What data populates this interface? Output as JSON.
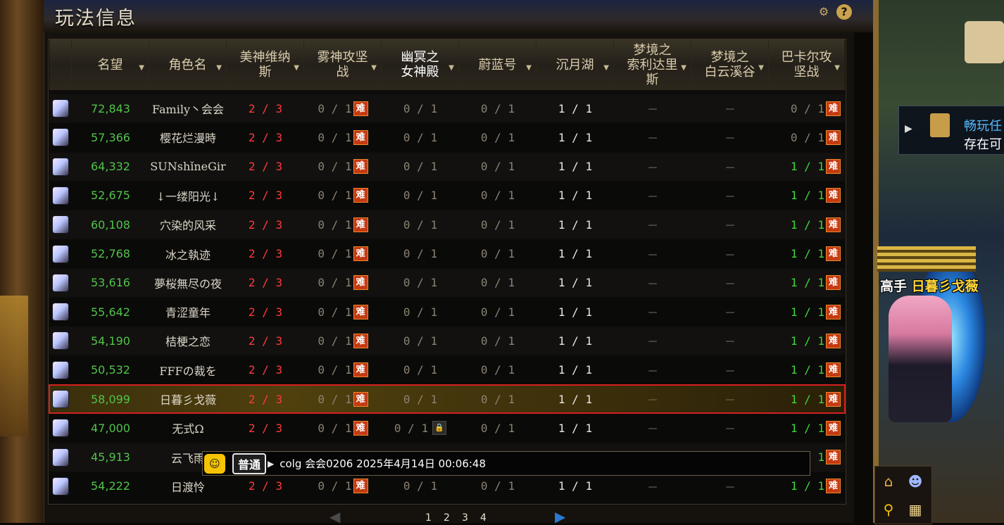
{
  "title": "玩法信息",
  "icons": {
    "settings": "gear-icon",
    "help": "?"
  },
  "header": [
    {
      "label": "名望",
      "special": false
    },
    {
      "label": "角色名",
      "special": false
    },
    {
      "label": "美神维纳\n斯",
      "special": false
    },
    {
      "label": "雾神攻坚\n战",
      "special": false
    },
    {
      "label": "幽冥之\n女神殿",
      "special": true
    },
    {
      "label": "蔚蓝号",
      "special": false
    },
    {
      "label": "沉月湖",
      "special": false
    },
    {
      "label": "梦境之\n索利达里\n斯",
      "special": false
    },
    {
      "label": "梦境之\n白云溪谷",
      "special": false
    },
    {
      "label": "巴卡尔攻\n坚战",
      "special": false
    }
  ],
  "hard_badge": "难",
  "rows": [
    {
      "fame": "72,843",
      "name": "Family丶会会",
      "venus": "2 / 3",
      "mist": "0 / 1",
      "ghost": "0 / 1",
      "blue": "0 / 1",
      "moon": "1 / 1",
      "dream1": "－",
      "dream2": "－",
      "bakal": "0 / 1",
      "bakal_color": "grey"
    },
    {
      "fame": "57,366",
      "name": "樱花烂漫時",
      "venus": "2 / 3",
      "mist": "0 / 1",
      "ghost": "0 / 1",
      "blue": "0 / 1",
      "moon": "1 / 1",
      "dream1": "－",
      "dream2": "－",
      "bakal": "0 / 1",
      "bakal_color": "grey"
    },
    {
      "fame": "64,332",
      "name": "SUNshǐneGir",
      "venus": "2 / 3",
      "mist": "0 / 1",
      "ghost": "0 / 1",
      "blue": "0 / 1",
      "moon": "1 / 1",
      "dream1": "－",
      "dream2": "－",
      "bakal": "1 / 1",
      "bakal_color": "green"
    },
    {
      "fame": "52,675",
      "name": "↓一缕阳光↓",
      "venus": "2 / 3",
      "mist": "0 / 1",
      "ghost": "0 / 1",
      "blue": "0 / 1",
      "moon": "1 / 1",
      "dream1": "－",
      "dream2": "－",
      "bakal": "1 / 1",
      "bakal_color": "green"
    },
    {
      "fame": "60,108",
      "name": "穴染的风采",
      "venus": "2 / 3",
      "mist": "0 / 1",
      "ghost": "0 / 1",
      "blue": "0 / 1",
      "moon": "1 / 1",
      "dream1": "－",
      "dream2": "－",
      "bakal": "1 / 1",
      "bakal_color": "green"
    },
    {
      "fame": "52,768",
      "name": "冰之執迹",
      "venus": "2 / 3",
      "mist": "0 / 1",
      "ghost": "0 / 1",
      "blue": "0 / 1",
      "moon": "1 / 1",
      "dream1": "－",
      "dream2": "－",
      "bakal": "1 / 1",
      "bakal_color": "green"
    },
    {
      "fame": "53,616",
      "name": "夢桜無尽の夜",
      "venus": "2 / 3",
      "mist": "0 / 1",
      "ghost": "0 / 1",
      "blue": "0 / 1",
      "moon": "1 / 1",
      "dream1": "－",
      "dream2": "－",
      "bakal": "1 / 1",
      "bakal_color": "green"
    },
    {
      "fame": "55,642",
      "name": "青涩童年",
      "venus": "2 / 3",
      "mist": "0 / 1",
      "ghost": "0 / 1",
      "blue": "0 / 1",
      "moon": "1 / 1",
      "dream1": "－",
      "dream2": "－",
      "bakal": "1 / 1",
      "bakal_color": "green"
    },
    {
      "fame": "54,190",
      "name": "桔梗之恋",
      "venus": "2 / 3",
      "mist": "0 / 1",
      "ghost": "0 / 1",
      "blue": "0 / 1",
      "moon": "1 / 1",
      "dream1": "－",
      "dream2": "－",
      "bakal": "1 / 1",
      "bakal_color": "green"
    },
    {
      "fame": "50,532",
      "name": "FFFの裁を",
      "venus": "2 / 3",
      "mist": "0 / 1",
      "ghost": "0 / 1",
      "blue": "0 / 1",
      "moon": "1 / 1",
      "dream1": "－",
      "dream2": "－",
      "bakal": "1 / 1",
      "bakal_color": "green"
    },
    {
      "fame": "58,099",
      "name": "日暮彡戈薇",
      "venus": "2 / 3",
      "mist": "0 / 1",
      "ghost": "0 / 1",
      "blue": "0 / 1",
      "moon": "1 / 1",
      "dream1": "－",
      "dream2": "－",
      "bakal": "1 / 1",
      "bakal_color": "green",
      "selected": true
    },
    {
      "fame": "47,000",
      "name": "无式Ω",
      "venus": "2 / 3",
      "mist": "0 / 1",
      "ghost": "0 / 1",
      "blue": "0 / 1",
      "moon": "1 / 1",
      "dream1": "－",
      "dream2": "－",
      "bakal": "1 / 1",
      "bakal_color": "green",
      "ghost_lock": true
    },
    {
      "fame": "45,913",
      "name": "云飞雨",
      "venus": "",
      "mist": "",
      "ghost": "",
      "blue": "",
      "moon": "",
      "dream1": "",
      "dream2": "",
      "bakal": "1",
      "bakal_color": "green"
    },
    {
      "fame": "54,222",
      "name": "日渡怜",
      "venus": "2 / 3",
      "mist": "0 / 1",
      "ghost": "0 / 1",
      "blue": "0 / 1",
      "moon": "1 / 1",
      "dream1": "－",
      "dream2": "－",
      "bakal": "1 / 1",
      "bakal_color": "green"
    }
  ],
  "chat": {
    "channel": "普通",
    "message": "colg 会会0206 2025年4月14日 00:06:48"
  },
  "pagination": {
    "pages": [
      "1",
      "2",
      "3",
      "4"
    ]
  },
  "side": {
    "quest_line1": "畅玩任",
    "quest_line2": "存在可",
    "char_title": "高手",
    "char_name": "日暮彡戈薇"
  }
}
